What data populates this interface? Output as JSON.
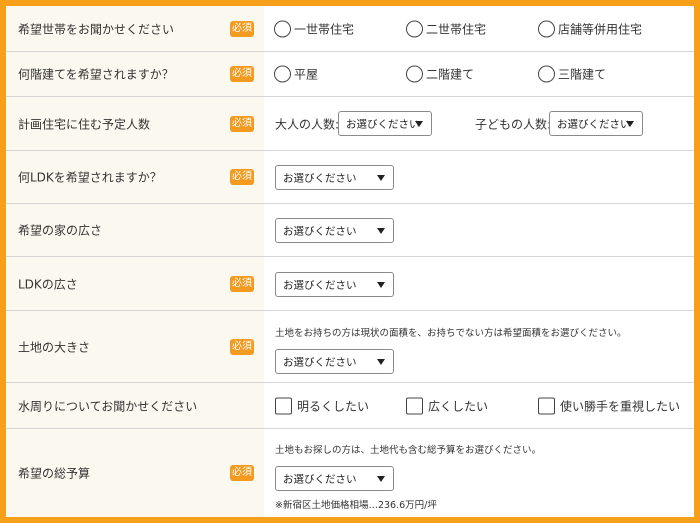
{
  "required_badge": "必須",
  "select_placeholder": "お選びください",
  "rows": {
    "household": {
      "label": "希望世帯をお聞かせください",
      "options": [
        "一世帯住宅",
        "二世帯住宅",
        "店舗等併用住宅"
      ]
    },
    "floors": {
      "label": "何階建てを希望されますか？",
      "options": [
        "平屋",
        "二階建て",
        "三階建て"
      ]
    },
    "residents": {
      "label": "計画住宅に住む予定人数",
      "adults_label": "大人の人数:",
      "children_label": "子どもの人数:"
    },
    "ldk": {
      "label": "何LDKを希望されますか？"
    },
    "house_size": {
      "label": "希望の家の広さ"
    },
    "ldk_size": {
      "label": "LDKの広さ"
    },
    "land_size": {
      "label": "土地の大きさ",
      "note": "土地をお持ちの方は現状の面積を、お持ちでない方は希望面積をお選びください。"
    },
    "water": {
      "label": "水周りについてお聞かせください",
      "options": [
        "明るくしたい",
        "広くしたい",
        "使い勝手を重視したい"
      ]
    },
    "budget": {
      "label": "希望の総予算",
      "note": "土地もお探しの方は、土地代も含む総予算をお選びください。",
      "price_note": "※新宿区土地価格相場…236.6万円/坪"
    }
  }
}
